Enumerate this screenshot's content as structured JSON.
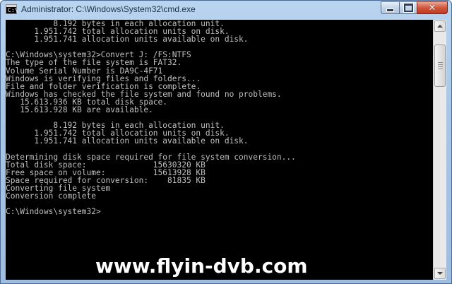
{
  "window": {
    "title": "Administrator: C:\\Windows\\System32\\cmd.exe",
    "icon": "command-prompt-icon",
    "icon_glyph": "C:\\",
    "controls": {
      "minimize_icon": "minimize-icon",
      "maximize_icon": "maximize-icon",
      "close_icon": "close-icon",
      "close_glyph": "✕"
    }
  },
  "console": {
    "lines": [
      "          8.192 bytes in each allocation unit.",
      "      1.951.742 total allocation units on disk.",
      "      1.951.741 allocation units available on disk.",
      "",
      "C:\\Windows\\system32>Convert J: /FS:NTFS",
      "The type of the file system is FAT32.",
      "Volume Serial Number is DA9C-4F71",
      "Windows is verifying files and folders...",
      "File and folder verification is complete.",
      "Windows has checked the file system and found no problems.",
      "   15.613.936 KB total disk space.",
      "   15.613.928 KB are available.",
      "",
      "          8.192 bytes in each allocation unit.",
      "      1.951.742 total allocation units on disk.",
      "      1.951.741 allocation units available on disk.",
      "",
      "Determining disk space required for file system conversion...",
      "Total disk space:              15630320 KB",
      "Free space on volume:          15613928 KB",
      "Space required for conversion:    81835 KB",
      "Converting file system",
      "Conversion complete",
      "",
      "C:\\Windows\\system32>"
    ],
    "text_color": "#c0c0c0",
    "background_color": "#000000"
  },
  "watermark": {
    "text": "www.flyin-dvb.com",
    "color": "#ffffff"
  },
  "scrollbar": {
    "up_icon": "scroll-up-arrow-icon",
    "down_icon": "scroll-down-arrow-icon"
  }
}
